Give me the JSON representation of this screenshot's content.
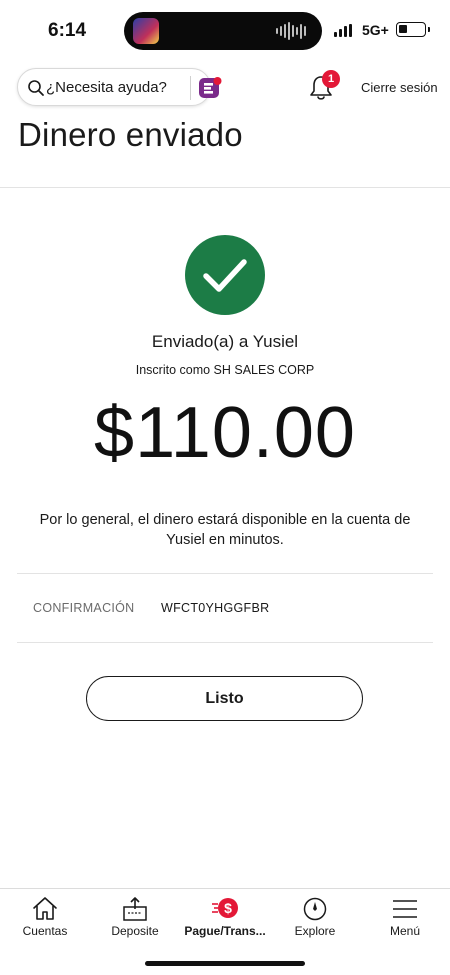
{
  "status_bar": {
    "time": "6:14",
    "network": "5G+",
    "battery_level": 0.35
  },
  "header": {
    "help_placeholder": "¿Necesita ayuda?",
    "notification_count": "1",
    "sign_out_label": "Cierre sesión"
  },
  "page": {
    "title": "Dinero enviado"
  },
  "confirmation": {
    "sent_to": "Enviado(a) a Yusiel",
    "enrolled_as": "Inscrito como SH SALES CORP",
    "amount": "$110.00",
    "availability_message": "Por lo general, el dinero estará disponible en la cuenta de Yusiel en minutos.",
    "confirmation_label": "CONFIRMACIÓN",
    "confirmation_code": "WFCT0YHGGFBR",
    "done_label": "Listo",
    "success_color": "#1c7c46"
  },
  "bottom_nav": {
    "items": [
      {
        "label": "Cuentas",
        "icon": "home-icon"
      },
      {
        "label": "Deposite",
        "icon": "deposit-icon"
      },
      {
        "label": "Pague/Trans...",
        "icon": "pay-transfer-icon",
        "active": true
      },
      {
        "label": "Explore",
        "icon": "compass-icon"
      },
      {
        "label": "Menú",
        "icon": "menu-icon"
      }
    ]
  },
  "colors": {
    "brand_red": "#e31837",
    "erica_purple": "#7a2a8a"
  }
}
